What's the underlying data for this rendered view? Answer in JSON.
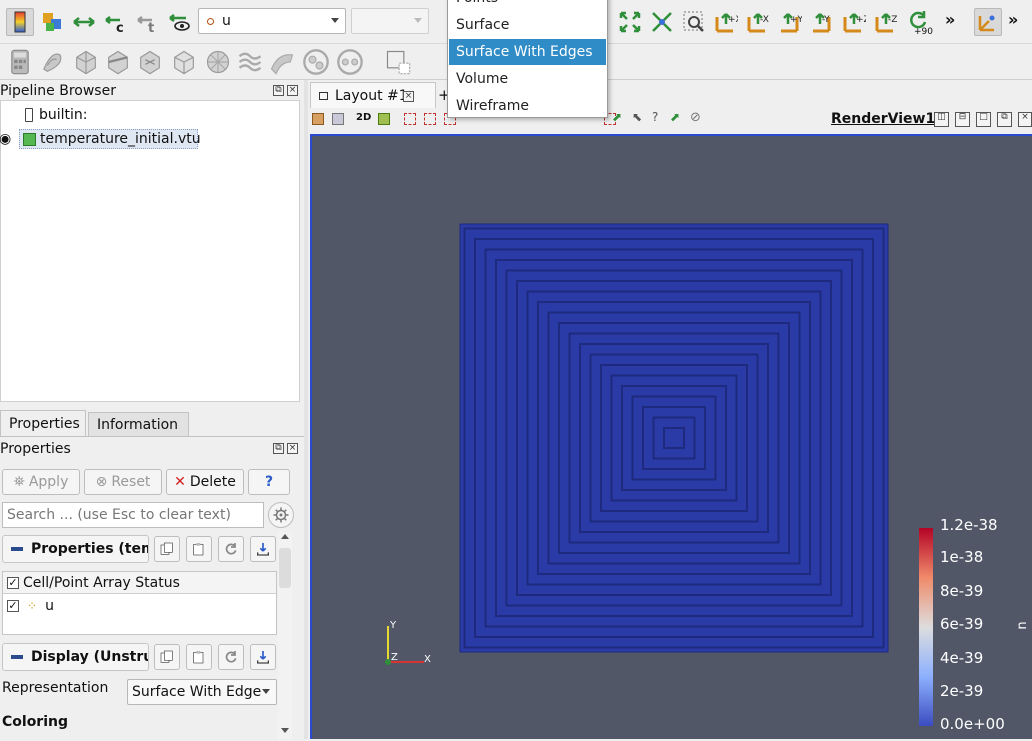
{
  "toolbar": {
    "array_select": "u",
    "component_select": "",
    "more_label": "»",
    "icons": [
      "color-map-icon",
      "color-legend-icon",
      "reset-range-icon",
      "custom-range-icon",
      "range-over-time-icon",
      "visible-range-icon",
      "reset-camera-icon",
      "zoom-to-data-icon",
      "zoom-to-box-icon",
      "plus-x-icon",
      "minus-x-icon",
      "plus-y-icon",
      "minus-y-icon",
      "plus-z-icon",
      "minus-z-icon",
      "rotate-90-icon",
      "axes-grid-icon"
    ],
    "axis_buttons": [
      "+X",
      "-X",
      "+Y",
      "-Y",
      "+Z",
      "-Z"
    ],
    "rotate_label": "+90"
  },
  "pipeline_browser": {
    "title": "Pipeline Browser",
    "items": [
      {
        "label": "builtin:"
      },
      {
        "label": "temperature_initial.vtu",
        "visible": true,
        "selected": true
      }
    ]
  },
  "tabs": {
    "properties": "Properties",
    "information": "Information"
  },
  "properties_panel": {
    "title": "Properties",
    "apply": "Apply",
    "reset": "Reset",
    "delete": "Delete",
    "help": "?",
    "search_placeholder": "Search ... (use Esc to clear text)",
    "section_properties": "Properties (tem",
    "array_status_header": "Cell/Point Array Status",
    "arrays": [
      {
        "name": "u",
        "checked": true
      }
    ],
    "section_display": "Display (Unstru",
    "representation_label": "Representation",
    "representation_value": "Surface With Edge",
    "coloring_label": "Coloring"
  },
  "layout": {
    "tab_label": "Layout #1",
    "add_tab": "+",
    "render_view_label": "RenderView1",
    "mode_2d": "2D"
  },
  "representation_menu": {
    "items": [
      "Points",
      "Surface",
      "Surface With Edges",
      "Volume",
      "Wireframe"
    ],
    "selected": "Surface With Edges"
  },
  "color_legend": {
    "title": "u",
    "ticks": [
      "1.2e-38",
      "1e-38",
      "8e-39",
      "6e-39",
      "4e-39",
      "2e-39",
      "0.0e+00"
    ],
    "colors": {
      "top": "#b40426",
      "mid": "#dddddd",
      "bottom": "#3b4cc0"
    }
  },
  "orientation_axes": {
    "y": "Y",
    "z": "Z",
    "x": "X"
  },
  "colors": {
    "background": "#525768",
    "mesh": "#2a3aa6",
    "mesh_edges": "#1d2a7e",
    "selection": "#308cc6",
    "active_border": "#2a4bd0"
  }
}
